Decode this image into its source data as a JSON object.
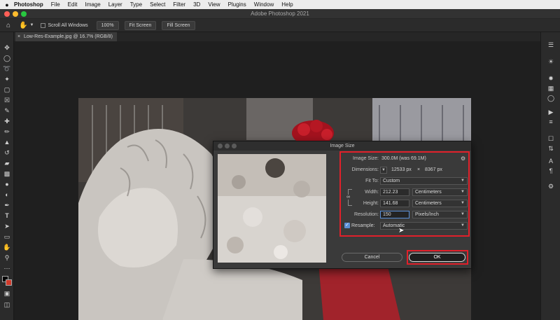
{
  "menubar": {
    "apple": "",
    "app_name": "Photoshop",
    "items": [
      "File",
      "Edit",
      "Image",
      "Layer",
      "Type",
      "Select",
      "Filter",
      "3D",
      "View",
      "Plugins",
      "Window",
      "Help"
    ]
  },
  "window": {
    "title": "Adobe Photoshop 2021"
  },
  "options_bar": {
    "scroll_all_windows": "Scroll All Windows",
    "zoom_100": "100%",
    "fit_screen": "Fit Screen",
    "fill_screen": "Fill Screen"
  },
  "document_tab": {
    "label": "Low-Res-Example.jpg @ 16.7% (RGB/8)",
    "close": "×"
  },
  "dialog": {
    "title": "Image Size",
    "image_size_label": "Image Size:",
    "image_size_value": "300.0M (was 69.1M)",
    "dimensions_label": "Dimensions:",
    "dimensions_width": "12533 px",
    "dimensions_x": "×",
    "dimensions_height": "8367 px",
    "fit_to_label": "Fit To:",
    "fit_to_value": "Custom",
    "width_label": "Width:",
    "width_value": "212.23",
    "width_unit": "Centimeters",
    "height_label": "Height:",
    "height_value": "141.68",
    "height_unit": "Centimeters",
    "resolution_label": "Resolution:",
    "resolution_value": "150",
    "resolution_unit": "Pixels/Inch",
    "resample_label": "Resample:",
    "resample_value": "Automatic",
    "resample_checked": true,
    "cancel_label": "Cancel",
    "ok_label": "OK"
  },
  "colors": {
    "highlight_red": "#e0202a",
    "menubar_bg": "#ececec",
    "app_bg": "#1e1e1e"
  }
}
